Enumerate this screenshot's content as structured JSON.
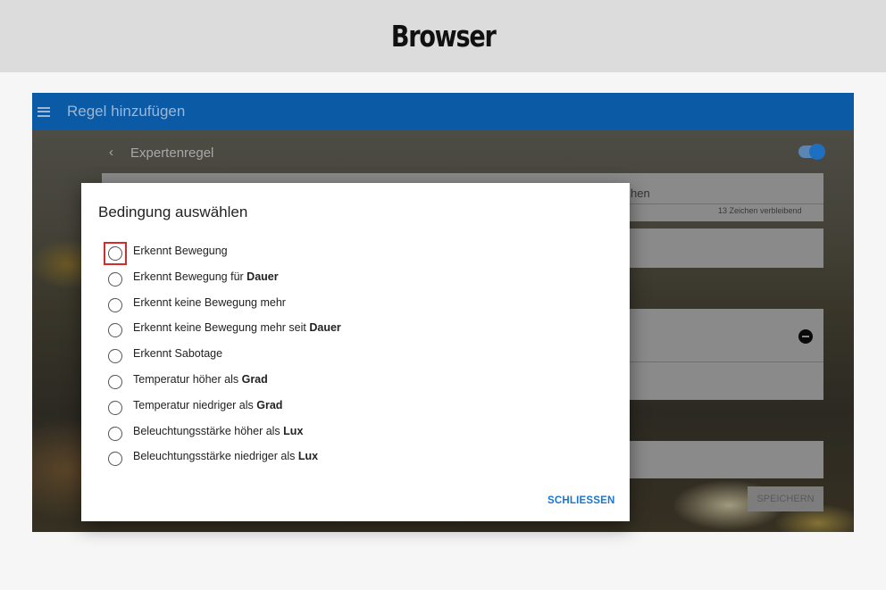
{
  "banner": {
    "title": "Browser"
  },
  "appbar": {
    "title": "Regel hinzufügen",
    "menu_icon": "hamburger-menu-icon"
  },
  "background_form": {
    "back_icon": "chevron-left-icon",
    "back_label": "Expertenregel",
    "toggle_on": true,
    "name_field_partial_text": "hen",
    "name_field_counter": "13 Zeichen verbleibend",
    "remove_icon": "minus-circle-icon",
    "save_label": "SPEICHERN"
  },
  "dialog": {
    "title": "Bedingung auswählen",
    "focused_index": 0,
    "options": [
      {
        "text": "Erkennt Bewegung",
        "bold": ""
      },
      {
        "text": "Erkennt Bewegung für ",
        "bold": "Dauer"
      },
      {
        "text": "Erkennt keine Bewegung mehr",
        "bold": ""
      },
      {
        "text": "Erkennt keine Bewegung mehr seit ",
        "bold": "Dauer"
      },
      {
        "text": "Erkennt Sabotage",
        "bold": ""
      },
      {
        "text": "Temperatur höher als ",
        "bold": "Grad"
      },
      {
        "text": "Temperatur niedriger als ",
        "bold": "Grad"
      },
      {
        "text": "Beleuchtungsstärke höher als ",
        "bold": "Lux"
      },
      {
        "text": "Beleuchtungsstärke niedriger als ",
        "bold": "Lux"
      }
    ],
    "close_label": "SCHLIESSEN"
  },
  "colors": {
    "appbar": "#0a5aa6",
    "accent": "#1976d2",
    "focus_ring": "#d42a2a"
  }
}
